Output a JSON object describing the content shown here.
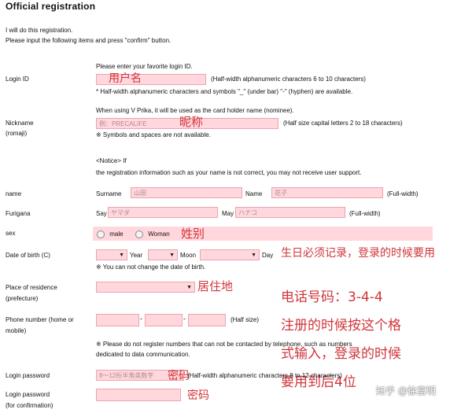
{
  "header": {
    "title": "Official registration",
    "intro1": "I will do this registration.",
    "intro2": "Please input the following items and press \"confirm\" button."
  },
  "login_id": {
    "label": "Login ID",
    "hint": "Please enter your favorite login ID.",
    "note_after": "(Half-width alphanumeric characters 6 to 10 characters)",
    "note_below": "* Half-width alphanumeric characters and symbols \"_\" (under bar) \"-\" (hyphen) are available.",
    "annotation": "用户名"
  },
  "nickname": {
    "label1": "Nickname",
    "label2": "(romaji)",
    "hint": "When using V Prika, it will be used as the card holder name (nominee).",
    "placeholder": "例：PRECALIFE",
    "note_after": "(Half size capital letters 2 to 18 characters)",
    "note_below": "※ Symbols and spaces are not available.",
    "annotation": "昵称"
  },
  "notice": {
    "line1": "<Notice> If",
    "line2": "the registration information such as your name is not correct, you may not receive user support."
  },
  "name": {
    "label": "name",
    "surname_label": "Surname",
    "surname_placeholder": "山田",
    "name_label": "Name",
    "name_placeholder": "花子",
    "note_after": "(Full-width)"
  },
  "furigana": {
    "label": "Furigana",
    "say_label": "Say",
    "say_placeholder": "ヤマダ",
    "may_label": "May",
    "may_placeholder": "ハナコ",
    "note_after": "(Full-width)"
  },
  "sex": {
    "label": "sex",
    "male": "male",
    "female": "Woman",
    "annotation": "姓别"
  },
  "dob": {
    "label": "Date of birth (C)",
    "year": "Year",
    "moon": "Moon",
    "day": "Day",
    "note": "※ You can not change the date of birth.",
    "annotation": "生日必须记录，登录的时候要用"
  },
  "residence": {
    "label1": "Place of residence",
    "label2": "(prefecture)",
    "annotation": "居住地"
  },
  "phone": {
    "label1": "Phone number (home or",
    "label2": "mobile)",
    "dash": "-",
    "note_after": "(Half size)",
    "note1": "※ Please do not register numbers that can not be contacted by telephone, such as numbers",
    "note2": "dedicated to data communication."
  },
  "phone_annotation": {
    "line1": "电话号码：3-4-4",
    "line2": "注册的时候按这个格",
    "line3": "式输入，登录的时候",
    "line4": "要用到后4位"
  },
  "password": {
    "label": "Login password",
    "placeholder": "8～12桁半角英数字",
    "note_after": "(Half-width alphanumeric characters 8 to 12 characters)",
    "annotation": "密码"
  },
  "password_confirm": {
    "label1": "Login password",
    "label2": "(for confirmation)",
    "annotation": "密码"
  },
  "watermark": "知乎 @徐富明",
  "colors": {
    "field_bg": "#ffd7dc",
    "field_border": "#e9a5ae",
    "annotation": "#d0343a"
  }
}
